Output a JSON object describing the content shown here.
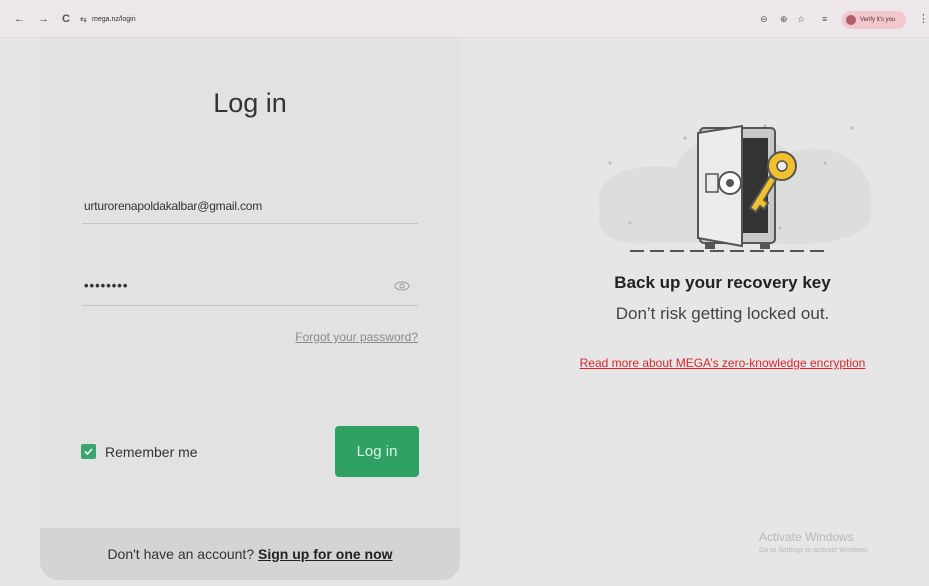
{
  "browser": {
    "back_icon": "←",
    "forward_icon": "→",
    "reload_icon": "C",
    "tune_icon": "⇆",
    "url": "mega.nz/login",
    "key_icon": "⊖",
    "zoom_icon": "⊕",
    "star_icon": "☆",
    "media_icon": "≡",
    "verify_label": "Verify it's you",
    "menu_icon": "⋮"
  },
  "login_card": {
    "title": "Log in",
    "email_value": "urturorenapoldakalbar@gmail.com",
    "password_value": "••••••••",
    "forgot_link": "Forgot your password?",
    "remember_label": "Remember me",
    "remember_checked": true,
    "login_button": "Log in",
    "signup_prompt": "Don't have an account? ",
    "signup_link": "Sign up for one now"
  },
  "promo": {
    "title": "Back up your recovery key",
    "subtitle": "Don’t risk getting locked out.",
    "link": "Read more about MEGA’s zero-knowledge encryption"
  },
  "watermark": {
    "line1": "Activate Windows",
    "line2": "Go to Settings to activate Windows."
  },
  "colors": {
    "accent_green": "#2ea163",
    "link_red": "#d9272e"
  }
}
